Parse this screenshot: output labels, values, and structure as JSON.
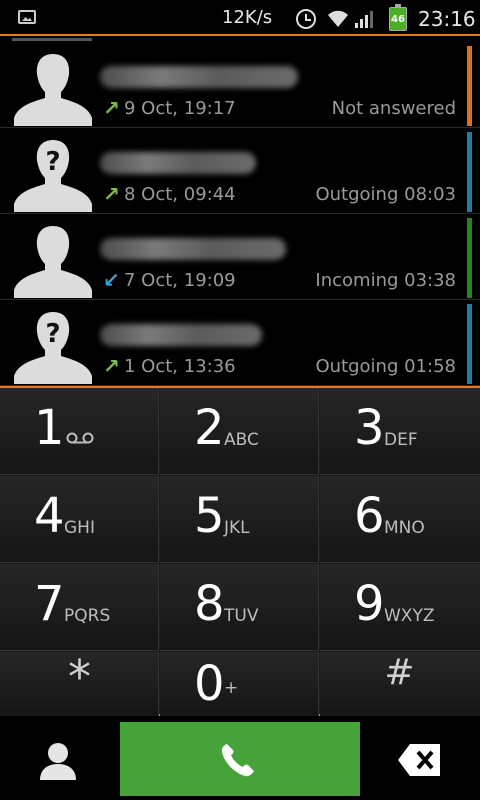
{
  "status_bar": {
    "speed": "12K/s",
    "battery": "46",
    "time": "23:16",
    "icons": [
      "gallery-notification-icon",
      "alarm-icon",
      "wifi-icon",
      "signal-icon",
      "battery-icon"
    ]
  },
  "call_log": [
    {
      "avatar": "contact-silhouette",
      "direction": "outgoing",
      "date": "9 Oct, 19:17",
      "status": "Not answered",
      "accent": "#d9731e"
    },
    {
      "avatar": "unknown-silhouette",
      "direction": "outgoing",
      "date": "8 Oct, 09:44",
      "status": "Outgoing 08:03",
      "accent": "#1f7fa3"
    },
    {
      "avatar": "contact-silhouette",
      "direction": "incoming",
      "date": "7 Oct, 19:09",
      "status": "Incoming 03:38",
      "accent": "#1c8a1c"
    },
    {
      "avatar": "unknown-silhouette",
      "direction": "outgoing",
      "date": "1 Oct, 13:36",
      "status": "Outgoing 01:58",
      "accent": "#1f7fa3"
    }
  ],
  "dialpad": {
    "keys": [
      {
        "digit": "1",
        "letters": ""
      },
      {
        "digit": "2",
        "letters": "ABC"
      },
      {
        "digit": "3",
        "letters": "DEF"
      },
      {
        "digit": "4",
        "letters": "GHI"
      },
      {
        "digit": "5",
        "letters": "JKL"
      },
      {
        "digit": "6",
        "letters": "MNO"
      },
      {
        "digit": "7",
        "letters": "PQRS"
      },
      {
        "digit": "8",
        "letters": "TUV"
      },
      {
        "digit": "9",
        "letters": "WXYZ"
      },
      {
        "digit": "*",
        "letters": ""
      },
      {
        "digit": "0",
        "letters": "+"
      },
      {
        "digit": "#",
        "letters": ""
      }
    ]
  },
  "colors": {
    "accent_orange": "#e87722",
    "call_green": "#45a33a",
    "outgoing_arrow": "#7bc043",
    "incoming_arrow": "#3aa0e0"
  }
}
